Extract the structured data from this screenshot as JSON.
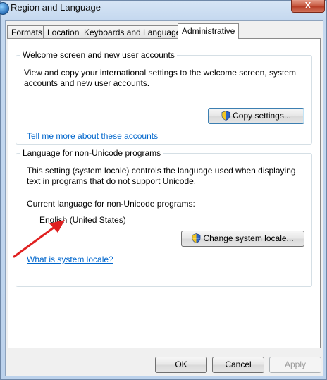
{
  "window": {
    "title": "Region and Language",
    "close_label": "X"
  },
  "tabs": [
    {
      "label": "Formats"
    },
    {
      "label": "Location"
    },
    {
      "label": "Keyboards and Languages"
    },
    {
      "label": "Administrative",
      "active": true
    }
  ],
  "welcome": {
    "title": "Welcome screen and new user accounts",
    "desc_line1": "View and copy your international settings to the welcome screen, system",
    "desc_line2": "accounts and new user accounts.",
    "copy_button": "Copy settings...",
    "link": "Tell me more about these accounts"
  },
  "nonunicode": {
    "title": "Language for non-Unicode programs",
    "desc_line1": "This setting (system locale) controls the language used when displaying",
    "desc_line2": "text in programs that do not support Unicode.",
    "current_label": "Current language for non-Unicode programs:",
    "current_value": "English (United States)",
    "change_button": "Change system locale...",
    "link": "What is system locale?"
  },
  "footer": {
    "ok": "OK",
    "cancel": "Cancel",
    "apply": "Apply"
  },
  "colors": {
    "annotation_arrow": "#e02020",
    "link": "#0066cc"
  }
}
